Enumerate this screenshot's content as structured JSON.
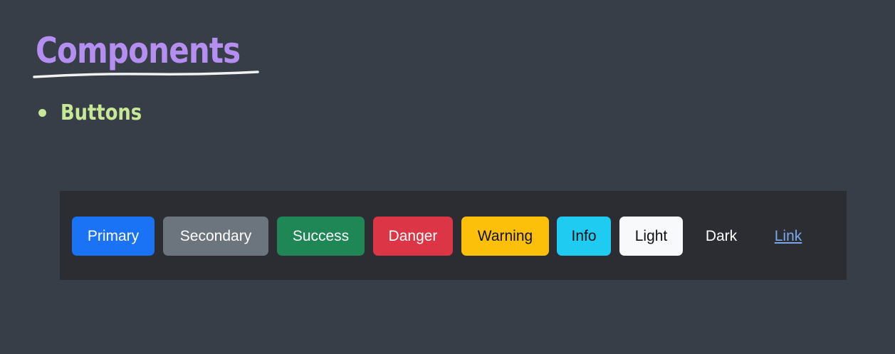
{
  "slide": {
    "title": "Components",
    "bullet": "Buttons"
  },
  "colors": {
    "background": "#383e48",
    "title": "#b48ef0",
    "underline": "#f2f2f2",
    "bullet": "#c6e897",
    "bar": "#2b2d33"
  },
  "buttons": [
    {
      "label": "Primary",
      "bg": "#1a72f5",
      "fg": "#ffffff"
    },
    {
      "label": "Secondary",
      "bg": "#6c757d",
      "fg": "#ffffff"
    },
    {
      "label": "Success",
      "bg": "#1f8755",
      "fg": "#ffffff"
    },
    {
      "label": "Danger",
      "bg": "#dc3545",
      "fg": "#ffffff"
    },
    {
      "label": "Warning",
      "bg": "#fcc00b",
      "fg": "#111111"
    },
    {
      "label": "Info",
      "bg": "#1fcbf0",
      "fg": "#111111"
    },
    {
      "label": "Light",
      "bg": "#f8f9fa",
      "fg": "#111111"
    },
    {
      "label": "Dark",
      "bg": "transparent",
      "fg": "#ffffff"
    },
    {
      "label": "Link",
      "bg": "transparent",
      "fg": "#7aa7ea"
    }
  ]
}
